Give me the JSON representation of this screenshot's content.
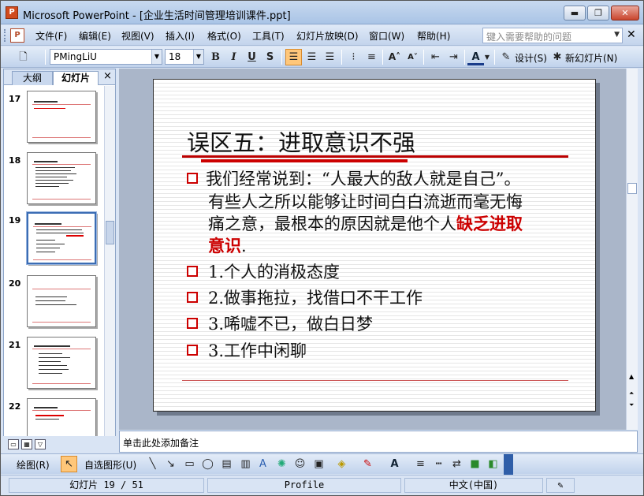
{
  "window": {
    "title": "Microsoft PowerPoint - [企业生活时间管理培训课件.ppt]",
    "min_label": "▬",
    "max_label": "❐",
    "close_label": "✕"
  },
  "menubar": {
    "items": [
      "文件(F)",
      "编辑(E)",
      "视图(V)",
      "插入(I)",
      "格式(O)",
      "工具(T)",
      "幻灯片放映(D)",
      "窗口(W)",
      "帮助(H)"
    ],
    "help_placeholder": "键入需要帮助的问题",
    "doc_close": "✕"
  },
  "toolbar": {
    "font_name": "PMingLiU",
    "font_size": "18",
    "bold": "B",
    "italic": "I",
    "underline": "U",
    "shadow": "S",
    "design_label": "设计(S)",
    "new_slide_label": "新幻灯片(N)"
  },
  "leftpane": {
    "tab_outline": "大纲",
    "tab_slides": "幻灯片",
    "close": "×",
    "thumbnails": [
      {
        "num": "17",
        "selected": false
      },
      {
        "num": "18",
        "selected": false
      },
      {
        "num": "19",
        "selected": true
      },
      {
        "num": "20",
        "selected": false
      },
      {
        "num": "21",
        "selected": false
      },
      {
        "num": "22",
        "selected": false
      }
    ]
  },
  "slide": {
    "title": "误区五：进取意识不强",
    "intro_line1": " 我们经常说到：“人最大的敌人就是自己”。",
    "intro_line2": "有些人之所以能够让时间白白流逝而毫无悔",
    "intro_line3": "痛之意，最根本的原因就是他个人",
    "intro_red": "缺乏进取",
    "intro_line4_red": "意识",
    "intro_line4_end": ".",
    "bullets": [
      "1.个人的消极态度",
      "2.做事拖拉，找借口不干工作",
      "3.唏嘘不已，做白日梦",
      "3.工作中闲聊"
    ]
  },
  "notes": {
    "placeholder": "单击此处添加备注"
  },
  "drawbar": {
    "draw_label": "绘图(R)",
    "autoshape_label": "自选图形(U)"
  },
  "status": {
    "slide_pos": "幻灯片 19 / 51",
    "design": "Profile",
    "language": "中文(中国)"
  },
  "colors": {
    "accent_red": "#cc0000",
    "title_bar": "#a9c4e6"
  }
}
